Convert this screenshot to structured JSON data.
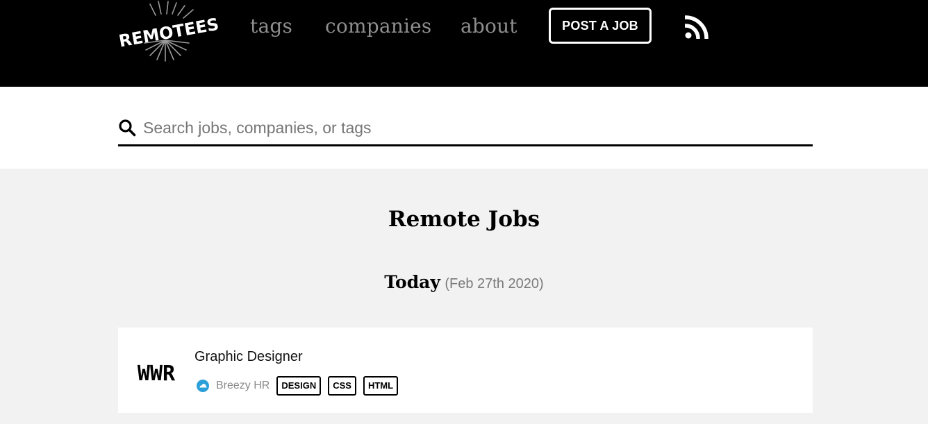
{
  "header": {
    "logo_text": "REMOTEES",
    "nav": {
      "tags": "tags",
      "companies": "companies",
      "about": "about"
    },
    "post_job_label": "POST A JOB",
    "rss_icon": "rss-icon"
  },
  "search": {
    "placeholder": "Search jobs, companies, or tags",
    "value": "",
    "icon": "search-icon"
  },
  "main": {
    "title": "Remote Jobs",
    "day": {
      "label": "Today",
      "date": "(Feb 27th 2020)"
    },
    "jobs": [
      {
        "logo_text": "WWR",
        "title": "Graphic Designer",
        "source": "Breezy HR",
        "source_icon": "breezy-hr-icon",
        "tags": [
          "DESIGN",
          "CSS",
          "HTML"
        ]
      }
    ]
  },
  "colors": {
    "header_bg": "#000000",
    "nav_text": "#8e8e8e",
    "page_bg": "#f2f2f2",
    "card_bg": "#ffffff",
    "source_icon": "#2d9fd9"
  }
}
